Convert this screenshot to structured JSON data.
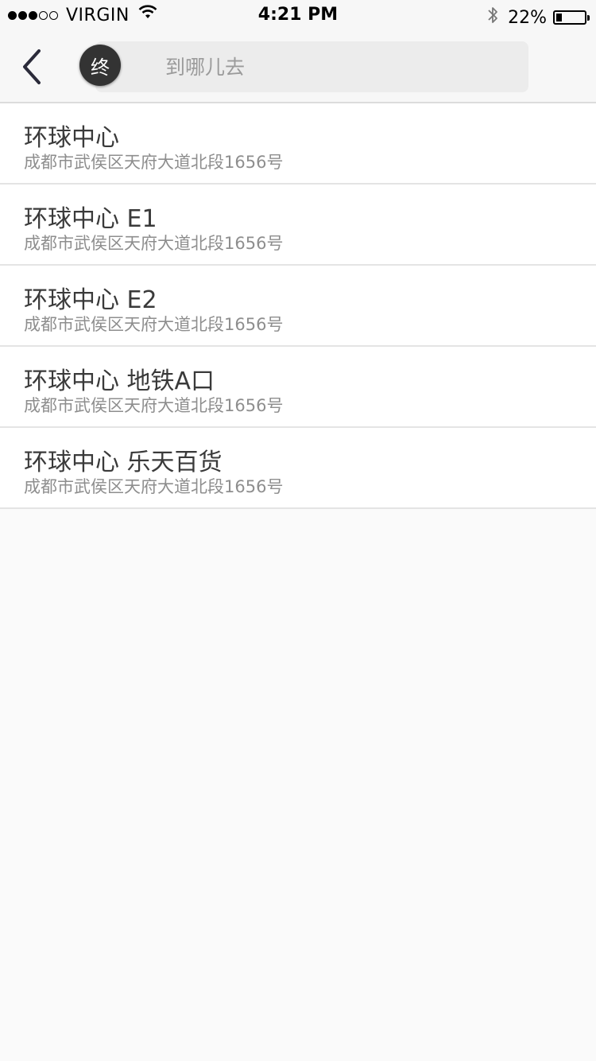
{
  "status_bar": {
    "carrier": "VIRGIN",
    "signal_bars_filled": 3,
    "signal_bars_total": 5,
    "time": "4:21 PM",
    "battery_percent_text": "22%",
    "battery_level": 0.22,
    "icons": [
      "wifi-icon",
      "bluetooth-icon",
      "battery-icon"
    ]
  },
  "nav": {
    "back_icon": "chevron-left-icon",
    "destination_badge": "终",
    "search_placeholder": "到哪儿去",
    "search_value": ""
  },
  "results": [
    {
      "name": "环球中心",
      "address": "成都市武侯区天府大道北段1656号"
    },
    {
      "name": "环球中心 E1",
      "address": "成都市武侯区天府大道北段1656号"
    },
    {
      "name": "环球中心 E2",
      "address": "成都市武侯区天府大道北段1656号"
    },
    {
      "name": "环球中心 地铁A口",
      "address": "成都市武侯区天府大道北段1656号"
    },
    {
      "name": "环球中心 乐天百货",
      "address": "成都市武侯区天府大道北段1656号"
    }
  ],
  "colors": {
    "background": "#fafafa",
    "bar": "#f7f7f7",
    "badge": "#333333",
    "primary_text": "#3a3a3a",
    "secondary_text": "#8e8e8e"
  }
}
